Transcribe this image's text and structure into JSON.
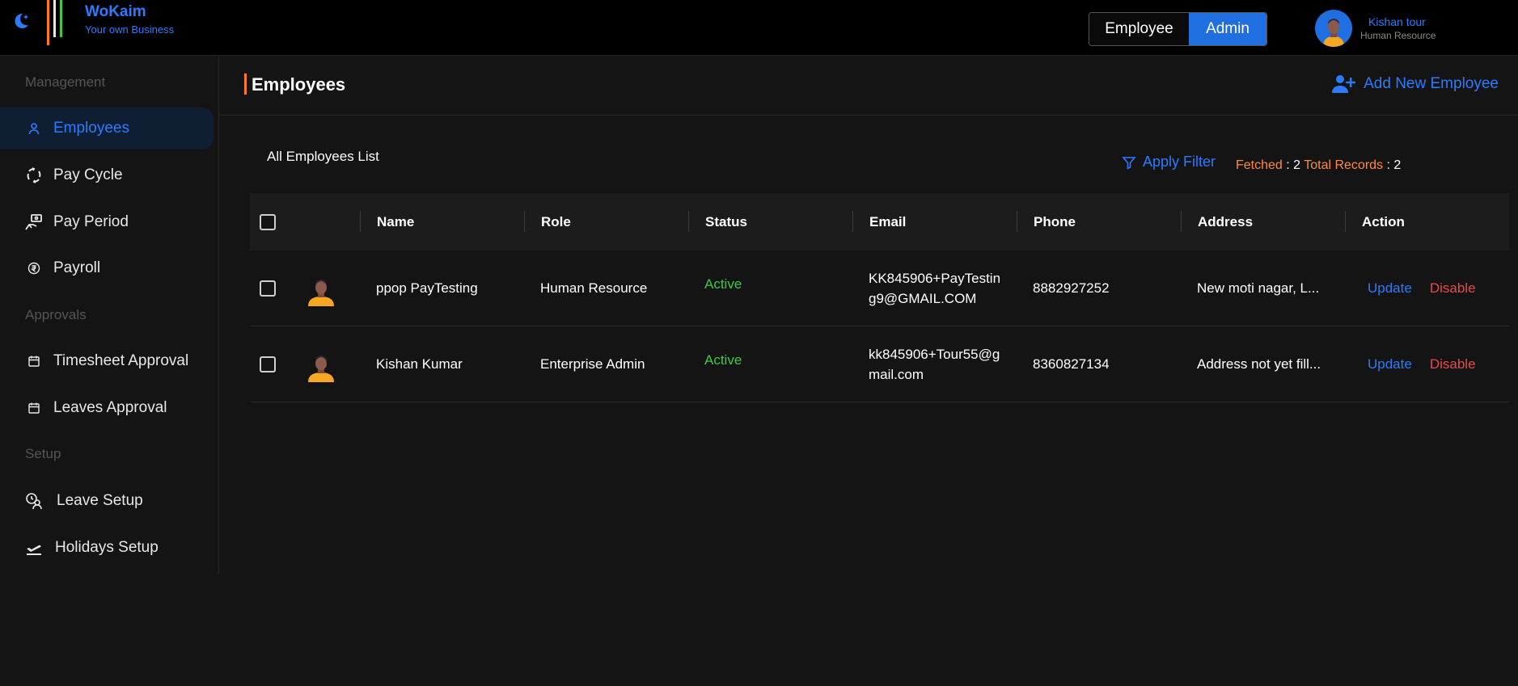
{
  "brand": {
    "name": "WoKaim",
    "tagline": "Your own Business"
  },
  "role_toggle": {
    "employee_label": "Employee",
    "admin_label": "Admin",
    "selected": "Admin"
  },
  "user": {
    "name": "Kishan tour",
    "role": "Human Resource"
  },
  "sidebar": {
    "sections": [
      {
        "title": "Management",
        "items": [
          {
            "label": "Employees",
            "icon": "user-icon",
            "active": true
          },
          {
            "label": "Pay Cycle",
            "icon": "cycle-icon"
          },
          {
            "label": "Pay Period",
            "icon": "money-hand-icon"
          },
          {
            "label": "Payroll",
            "icon": "currency-circle-icon"
          }
        ]
      },
      {
        "title": "Approvals",
        "items": [
          {
            "label": "Timesheet Approval",
            "icon": "calendar-icon"
          },
          {
            "label": "Leaves Approval",
            "icon": "calendar-icon"
          }
        ]
      },
      {
        "title": "Setup",
        "items": [
          {
            "label": "Leave Setup",
            "icon": "leave-setup-icon"
          },
          {
            "label": "Holidays Setup",
            "icon": "plane-departure-icon"
          }
        ]
      }
    ]
  },
  "page": {
    "title": "Employees",
    "add_label": "Add New Employee",
    "list_title": "All Employees List",
    "filter_label": "Apply Filter",
    "fetched_label": "Fetched",
    "fetched_value": "2",
    "total_label": "Total Records",
    "total_value": "2",
    "separator": ":"
  },
  "table": {
    "columns": [
      "Name",
      "Role",
      "Status",
      "Email",
      "Phone",
      "Address",
      "Action"
    ],
    "rows": [
      {
        "name": "ppop PayTesting",
        "role": "Human Resource",
        "status": "Active",
        "email": "KK845906+PayTesting9@GMAIL.COM",
        "phone": "8882927252",
        "address": "New moti nagar, L...",
        "update": "Update",
        "disable": "Disable"
      },
      {
        "name": "Kishan Kumar",
        "role": "Enterprise Admin",
        "status": "Active",
        "email": "kk845906+Tour55@gmail.com",
        "phone": "8360827134",
        "address": "Address not yet fill...",
        "update": "Update",
        "disable": "Disable"
      }
    ]
  },
  "colors": {
    "accent": "#2b7bff",
    "orange": "#ff7a1a",
    "active_green": "#3ec93e",
    "danger": "#e84a4a"
  }
}
